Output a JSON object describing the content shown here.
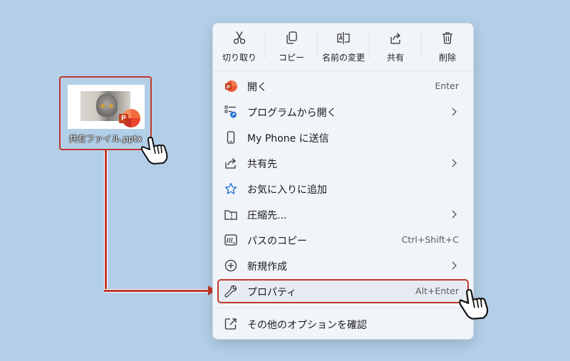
{
  "file": {
    "name": "共有ファイル.pptx"
  },
  "toolbar": {
    "cut": "切り取り",
    "copy": "コピー",
    "rename": "名前の変更",
    "share": "共有",
    "delete": "削除"
  },
  "menu": {
    "open": {
      "label": "開く",
      "shortcut": "Enter"
    },
    "open_with": {
      "label": "プログラムから開く"
    },
    "send_to_phone": {
      "label": "My Phone に送信"
    },
    "share_to": {
      "label": "共有先"
    },
    "favorite": {
      "label": "お気に入りに追加"
    },
    "compress": {
      "label": "圧縮先..."
    },
    "copy_path": {
      "label": "パスのコピー",
      "shortcut": "Ctrl+Shift+C"
    },
    "new": {
      "label": "新規作成"
    },
    "properties": {
      "label": "プロパティ",
      "shortcut": "Alt+Enter"
    },
    "more_options": {
      "label": "その他のオプションを確認"
    }
  },
  "colors": {
    "accent": "#c0392b",
    "background": "#b3cfe8",
    "menu_bg": "#f1f4f9"
  }
}
